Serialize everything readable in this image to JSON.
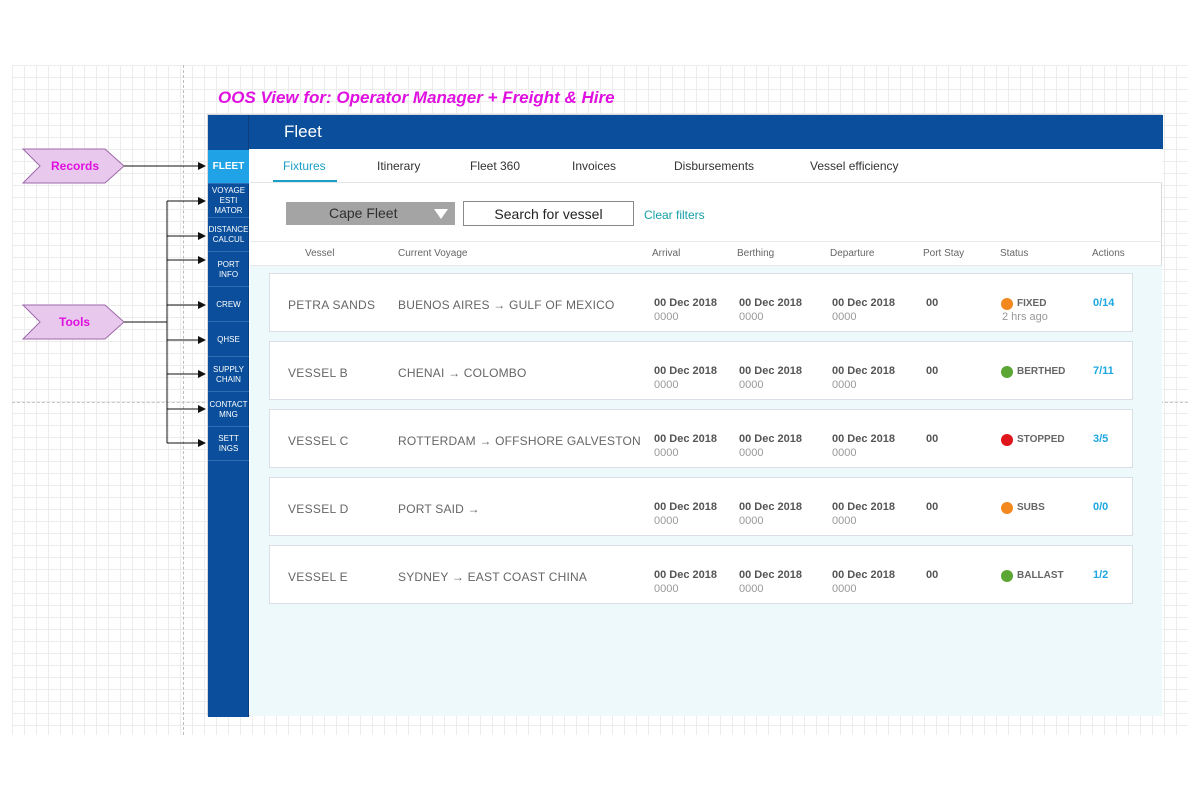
{
  "annotation_title": "OOS View for: Operator Manager + Freight & Hire",
  "annotations": {
    "records_label": "Records",
    "tools_label": "Tools",
    "shape_fill": "#e8c8ec",
    "shape_stroke": "#9c6aa8"
  },
  "app": {
    "title": "Fleet",
    "brand_color": "#0b4f9c",
    "accent_color": "#1fa3e6"
  },
  "sidebar": {
    "items": [
      {
        "label": "FLEET",
        "active": true
      },
      {
        "label": "VOYAGE ESTI MATOR"
      },
      {
        "label": "DISTANCE CALCUL"
      },
      {
        "label": "PORT INFO"
      },
      {
        "label": "CREW"
      },
      {
        "label": "QHSE"
      },
      {
        "label": "SUPPLY CHAIN"
      },
      {
        "label": "CONTACT MNG"
      },
      {
        "label": "SETT INGS"
      }
    ]
  },
  "tabs": [
    {
      "label": "Fixtures",
      "active": true
    },
    {
      "label": "Itinerary"
    },
    {
      "label": "Fleet 360"
    },
    {
      "label": "Invoices"
    },
    {
      "label": "Disbursements"
    },
    {
      "label": "Vessel efficiency"
    }
  ],
  "filters": {
    "fleet_select": "Cape Fleet",
    "search_placeholder": "Search for vessel",
    "clear_label": "Clear filters"
  },
  "table": {
    "headers": {
      "vessel": "Vessel",
      "voyage": "Current Voyage",
      "arrival": "Arrival",
      "berthing": "Berthing",
      "departure": "Departure",
      "port_stay": "Port Stay",
      "status": "Status",
      "actions": "Actions"
    },
    "rows": [
      {
        "vessel": "PETRA SANDS",
        "voyage": "BUENOS AIRES → GULF OF MEXICO",
        "arrival": "00 Dec 2018",
        "arrival_time": "0000",
        "berthing": "00 Dec 2018",
        "berthing_time": "0000",
        "departure": "00 Dec 2018",
        "departure_time": "0000",
        "port_stay": "00",
        "status": "FIXED",
        "status_color": "#f2881e",
        "status_ago": "2 hrs ago",
        "actions": "0/14"
      },
      {
        "vessel": "VESSEL B",
        "voyage": "CHENAI → COLOMBO",
        "arrival": "00 Dec 2018",
        "arrival_time": "0000",
        "berthing": "00 Dec 2018",
        "berthing_time": "0000",
        "departure": "00 Dec 2018",
        "departure_time": "0000",
        "port_stay": "00",
        "status": "BERTHED",
        "status_color": "#5ba634",
        "status_ago": "",
        "actions": "7/11"
      },
      {
        "vessel": "VESSEL C",
        "voyage": "ROTTERDAM → OFFSHORE GALVESTON",
        "arrival": "00 Dec 2018",
        "arrival_time": "0000",
        "berthing": "00 Dec 2018",
        "berthing_time": "0000",
        "departure": "00 Dec 2018",
        "departure_time": "0000",
        "port_stay": "00",
        "status": "STOPPED",
        "status_color": "#e0141b",
        "status_ago": "",
        "actions": "3/5"
      },
      {
        "vessel": "VESSEL D",
        "voyage": "PORT SAID →",
        "arrival": "00 Dec 2018",
        "arrival_time": "0000",
        "berthing": "00 Dec 2018",
        "berthing_time": "0000",
        "departure": "00 Dec 2018",
        "departure_time": "0000",
        "port_stay": "00",
        "status": "SUBS",
        "status_color": "#f2881e",
        "status_ago": "",
        "actions": "0/0"
      },
      {
        "vessel": "VESSEL E",
        "voyage": "SYDNEY → EAST COAST CHINA",
        "arrival": "00 Dec 2018",
        "arrival_time": "0000",
        "berthing": "00 Dec 2018",
        "berthing_time": "0000",
        "departure": "00 Dec 2018",
        "departure_time": "0000",
        "port_stay": "00",
        "status": "BALLAST",
        "status_color": "#5ba634",
        "status_ago": "",
        "actions": "1/2"
      }
    ]
  }
}
